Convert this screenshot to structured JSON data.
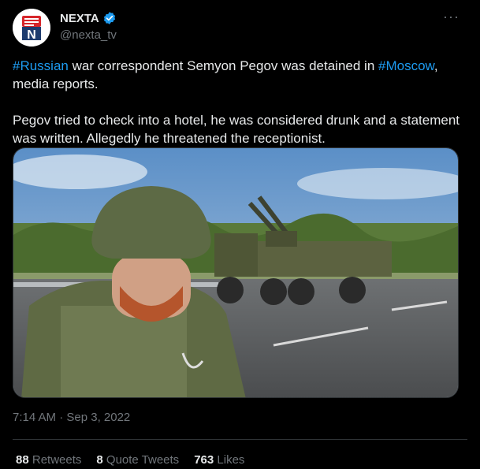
{
  "author": {
    "display_name": "NEXTA",
    "handle": "@nexta_tv",
    "verified": true,
    "avatar_icon": "nexta-logo",
    "avatar_letter": "N",
    "more_label": "···"
  },
  "tweet": {
    "paragraph1": {
      "hashtag1": "#Russian",
      "text1": " war correspondent Semyon Pegov was detained in ",
      "hashtag2": "#Moscow",
      "text2": ", media reports."
    },
    "paragraph2": "Pegov tried to check into a hotel, he was considered drunk and a statement was written. Allegedly he threatened the receptionist.",
    "timestamp": "7:14 AM · Sep 3, 2022"
  },
  "stats": {
    "retweets_count": "88",
    "retweets_label": "Retweets",
    "quotes_count": "8",
    "quotes_label": "Quote Tweets",
    "likes_count": "763",
    "likes_label": "Likes"
  },
  "colors": {
    "background": "#000000",
    "text": "#e7e9ea",
    "secondary": "#71767b",
    "accent": "#1d9bf0",
    "brand_red": "#d7262b",
    "brand_navy": "#1d3b6e"
  }
}
